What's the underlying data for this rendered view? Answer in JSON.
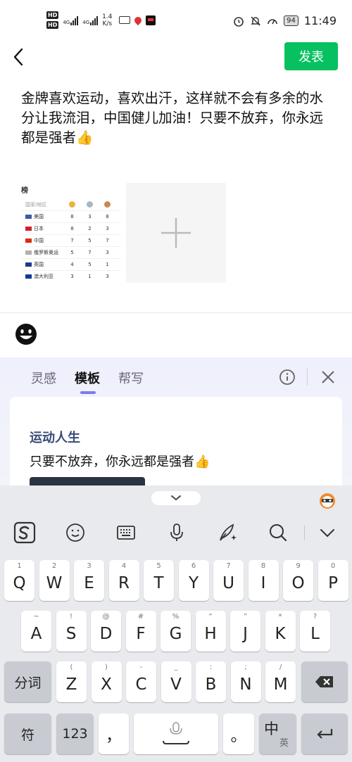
{
  "status_bar": {
    "net_speed_value": "1.4",
    "net_speed_unit": "K/s",
    "battery": "94",
    "time": "11:49",
    "hd1": "HD",
    "hd2": "HD",
    "sig1": "4G",
    "sig2": "4G"
  },
  "top_bar": {
    "publish_label": "发表"
  },
  "post": {
    "text": "金牌喜欢运动，喜欢出汗，这样就不会有多余的水分让我流泪，中国健儿加油！只要不放弃，你永远都是强者👍"
  },
  "medal_image": {
    "title": "榜",
    "header_country": "国家/地区",
    "rows": [
      {
        "country": "美国",
        "gold": "8",
        "silver": "3",
        "bronze": "8",
        "flag_color": "#3b5ba5"
      },
      {
        "country": "日本",
        "gold": "8",
        "silver": "2",
        "bronze": "3",
        "flag_color": "#d91c2a"
      },
      {
        "country": "中国",
        "gold": "7",
        "silver": "5",
        "bronze": "7",
        "flag_color": "#de2910"
      },
      {
        "country": "俄罗斯奥运",
        "gold": "5",
        "silver": "7",
        "bronze": "3",
        "flag_color": "#b0b0b0"
      },
      {
        "country": "英国",
        "gold": "4",
        "silver": "5",
        "bronze": "1",
        "flag_color": "#1e3a8a"
      },
      {
        "country": "澳大利亚",
        "gold": "3",
        "silver": "1",
        "bronze": "3",
        "flag_color": "#123a8c"
      }
    ]
  },
  "ai_panel": {
    "tabs": [
      "灵感",
      "模板",
      "帮写"
    ],
    "active_tab": "模板",
    "card_title": "运动人生",
    "card_text": "只要不放弃，你永远都是强者👍"
  },
  "keyboard": {
    "row1": [
      {
        "hint": "1",
        "key": "Q"
      },
      {
        "hint": "2",
        "key": "W"
      },
      {
        "hint": "3",
        "key": "E"
      },
      {
        "hint": "4",
        "key": "R"
      },
      {
        "hint": "5",
        "key": "T"
      },
      {
        "hint": "6",
        "key": "Y"
      },
      {
        "hint": "7",
        "key": "U"
      },
      {
        "hint": "8",
        "key": "I"
      },
      {
        "hint": "9",
        "key": "O"
      },
      {
        "hint": "0",
        "key": "P"
      }
    ],
    "row2": [
      {
        "hint": "~",
        "key": "A"
      },
      {
        "hint": "!",
        "key": "S"
      },
      {
        "hint": "@",
        "key": "D"
      },
      {
        "hint": "#",
        "key": "F"
      },
      {
        "hint": "%",
        "key": "G"
      },
      {
        "hint": "“",
        "key": "H"
      },
      {
        "hint": "”",
        "key": "J"
      },
      {
        "hint": "*",
        "key": "K"
      },
      {
        "hint": "?",
        "key": "L"
      }
    ],
    "row3": [
      {
        "hint": "(",
        "key": "Z"
      },
      {
        "hint": ")",
        "key": "X"
      },
      {
        "hint": "-",
        "key": "C"
      },
      {
        "hint": "_",
        "key": "V"
      },
      {
        "hint": ":",
        "key": "B"
      },
      {
        "hint": ";",
        "key": "N"
      },
      {
        "hint": "/",
        "key": "M"
      }
    ],
    "fenci": "分词",
    "fu": "符",
    "num": "123",
    "comma": "，",
    "period": "。",
    "zh": "中",
    "en": "英"
  },
  "colors": {
    "accent_green": "#07c160",
    "card_title": "#3a4a7a",
    "tab_indicator": "#7b7ee8"
  }
}
